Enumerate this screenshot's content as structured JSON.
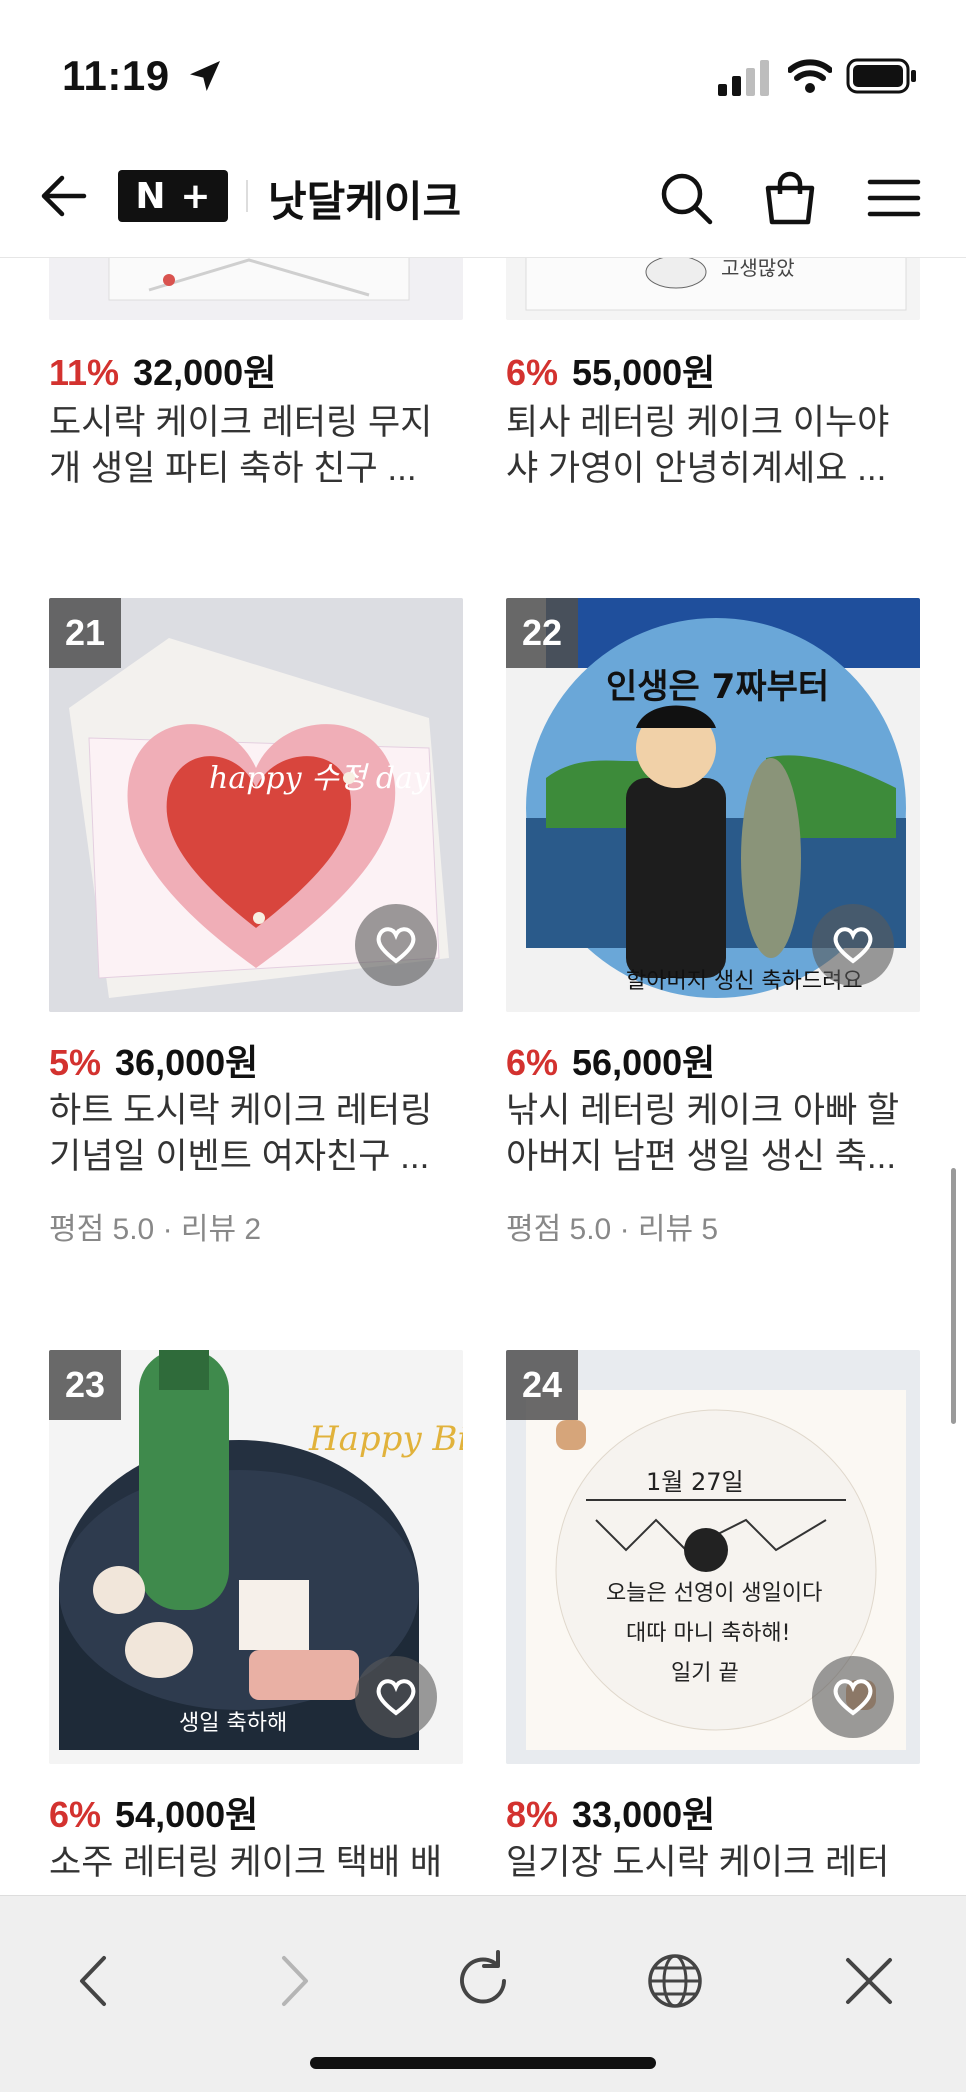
{
  "status": {
    "time": "11:19"
  },
  "header": {
    "logo_n": "N",
    "logo_plus": "+",
    "store_name": "낫달케이크"
  },
  "products": [
    {
      "rank": "",
      "discount": "11%",
      "price": "32,000원",
      "title_line1": "도시락 케이크 레터링 무지",
      "title_line2": "개 생일 파티 축하 친구 ...",
      "rating": ""
    },
    {
      "rank": "",
      "discount": "6%",
      "price": "55,000원",
      "title_line1": "퇴사 레터링 케이크 이누야",
      "title_line2": "샤 가영이 안녕히계세요 ...",
      "rating": ""
    },
    {
      "rank": "21",
      "discount": "5%",
      "price": "36,000원",
      "title_line1": "하트 도시락 케이크 레터링",
      "title_line2": "기념일 이벤트 여자친구 ...",
      "rating": "평점 5.0 · 리뷰 2"
    },
    {
      "rank": "22",
      "discount": "6%",
      "price": "56,000원",
      "title_line1": "낚시 레터링 케이크 아빠 할",
      "title_line2": "아버지 남편 생일 생신 축...",
      "rating": "평점 5.0 · 리뷰 5"
    },
    {
      "rank": "23",
      "discount": "6%",
      "price": "54,000원",
      "title_line1": "소주 레터링 케이크 택배 배",
      "title_line2": "",
      "rating": ""
    },
    {
      "rank": "24",
      "discount": "8%",
      "price": "33,000원",
      "title_line1": "일기장 도시락 케이크 레터",
      "title_line2": "",
      "rating": ""
    }
  ],
  "image_texts": {
    "p21": "happy 수정 day",
    "p22_top": "인생은 7짜부터",
    "p22_bottom": "할아버지 생신 축하드려요",
    "p23_top": "Happy Birthday",
    "p23_bottom": "생일 축하해",
    "p24_l1": "1월 27일",
    "p24_l2": "오늘은 선영이 생일이다",
    "p24_l3": "대따 마니 축하해!",
    "p24_l4": "일기 끝"
  },
  "colors": {
    "discount": "#d3322f",
    "rank_badge": "#505050",
    "bottom_bar": "#efefef"
  },
  "icons": [
    "location-arrow-icon",
    "cellular-signal-icon",
    "wifi-icon",
    "battery-icon",
    "back-arrow-icon",
    "search-icon",
    "shopping-bag-icon",
    "menu-icon",
    "heart-icon",
    "chevron-left-icon",
    "chevron-right-icon",
    "reload-icon",
    "globe-icon",
    "close-icon"
  ]
}
